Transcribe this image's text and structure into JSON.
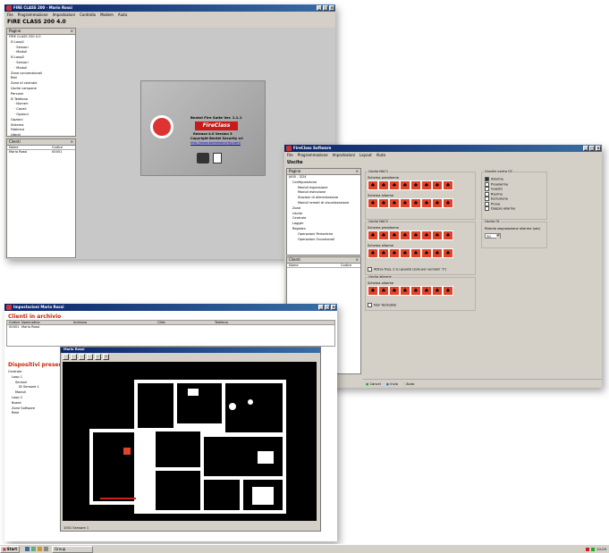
{
  "win1": {
    "title": "FIRE CLASS 200 - Mario Rossi",
    "menu": [
      "File",
      "Programmazione",
      "Impostazioni",
      "Controllo",
      "Modem",
      "Aiuto"
    ],
    "app_header": "FIRE CLASS 200 4.0",
    "pagine_header": "Pagine",
    "tree": [
      "FIRE CLASS 200 4.0",
      "⊟ Loop1",
      "· Sensori",
      "· Moduli",
      "⊟ Loop2",
      "· Sensori",
      "· Moduli",
      "Zone convenzionali",
      "Reti",
      "Zone di centrale",
      "Uscite campane",
      "Percorsi",
      "⊟ Telefono",
      "· Numeri",
      "· Canali",
      "· Opzioni",
      "Opzioni",
      "Sistema",
      "Fabbrica",
      "Utenti"
    ],
    "clienti_header": "Clienti",
    "clienti_cols": [
      "Nome",
      "Codice"
    ],
    "clienti_rows": [
      [
        "Mario Rossi",
        "00001"
      ]
    ],
    "splash": {
      "line1": "Bentel Fire Suite Ver. 1.1.1",
      "logo": "FireClass",
      "line2": "Release 4.0 Version 3",
      "line3": "Copyright Bentel Security srl",
      "link": "http://www.bentelsecurity.com/"
    }
  },
  "win2": {
    "title": "FireClass Software",
    "menu": [
      "File",
      "Programmazione",
      "Impostazioni",
      "Layout",
      "Aiuto"
    ],
    "section": "Uscite",
    "pagine_header": "Pagine",
    "tree": [
      "J400 - 3/24",
      "Configurazione",
      "Moduli espansione",
      "Moduli estinzione",
      "Stazioni di alimentazione",
      "Moduli remoti di visualizzazione",
      "Zone",
      "Uscite",
      "Centrale",
      "Logger",
      "Registro",
      "Operazioni Periodiche",
      "Operazioni Occasionali"
    ],
    "clienti_header": "Clienti",
    "clienti_cols": [
      "Nome",
      "Codice"
    ],
    "nac1": {
      "label": "Uscita NAC1",
      "preallarme": "Schema preallarme",
      "allarme": "Schema allarme"
    },
    "nac2": {
      "label": "Uscita NAC2",
      "preallarme": "Schema preallarme",
      "allarme": "Schema allarme",
      "check": "Attiva freq. 2 su guasto (solo per versioni '5')"
    },
    "allarme_grp": {
      "label": "Uscita allarme",
      "schema": "Schema allarme",
      "check": "Non Tacitabile"
    },
    "gradi": {
      "label": "Gradini uscita OC",
      "options": [
        "Allarme",
        "Preallarme",
        "Guasto",
        "Riarmo",
        "Esclusione",
        "Prova",
        "Doppio allarme"
      ],
      "checked": [
        true,
        false,
        false,
        false,
        false,
        false,
        false
      ]
    },
    "ol": {
      "label": "Uscita OL",
      "field_label": "Ritardo segnalazione allarme (sec)",
      "value": "30"
    },
    "footer": [
      "Cancel",
      "Invia",
      "Aiuto"
    ]
  },
  "win3": {
    "title": "Impostazioni Mario Rossi",
    "archive_title": "Clienti in archivio",
    "cols": [
      "Codice",
      "Nominativo",
      "Indirizzo",
      "Città",
      "Telefono"
    ],
    "rows": [
      [
        "00001",
        "Mario Rossi",
        "",
        "",
        ""
      ]
    ],
    "present_title": "Dispositivi presenti",
    "tree": [
      "Centrale",
      "Loop 1",
      "Sensori",
      "ID Sensore 1",
      "Moduli",
      "Loop 2",
      "Board",
      "Zone Software",
      "Rete"
    ],
    "plan_title": "Mario Rossi",
    "status": "1001 Sensore 1"
  },
  "taskbar": {
    "start": "Start",
    "task": "Group",
    "clock": "10:29"
  },
  "colors": {
    "titlebar": "#0a246a",
    "window_bg": "#d4d0c8",
    "accent_red": "#e0442a",
    "heading_red": "#cc2200"
  }
}
